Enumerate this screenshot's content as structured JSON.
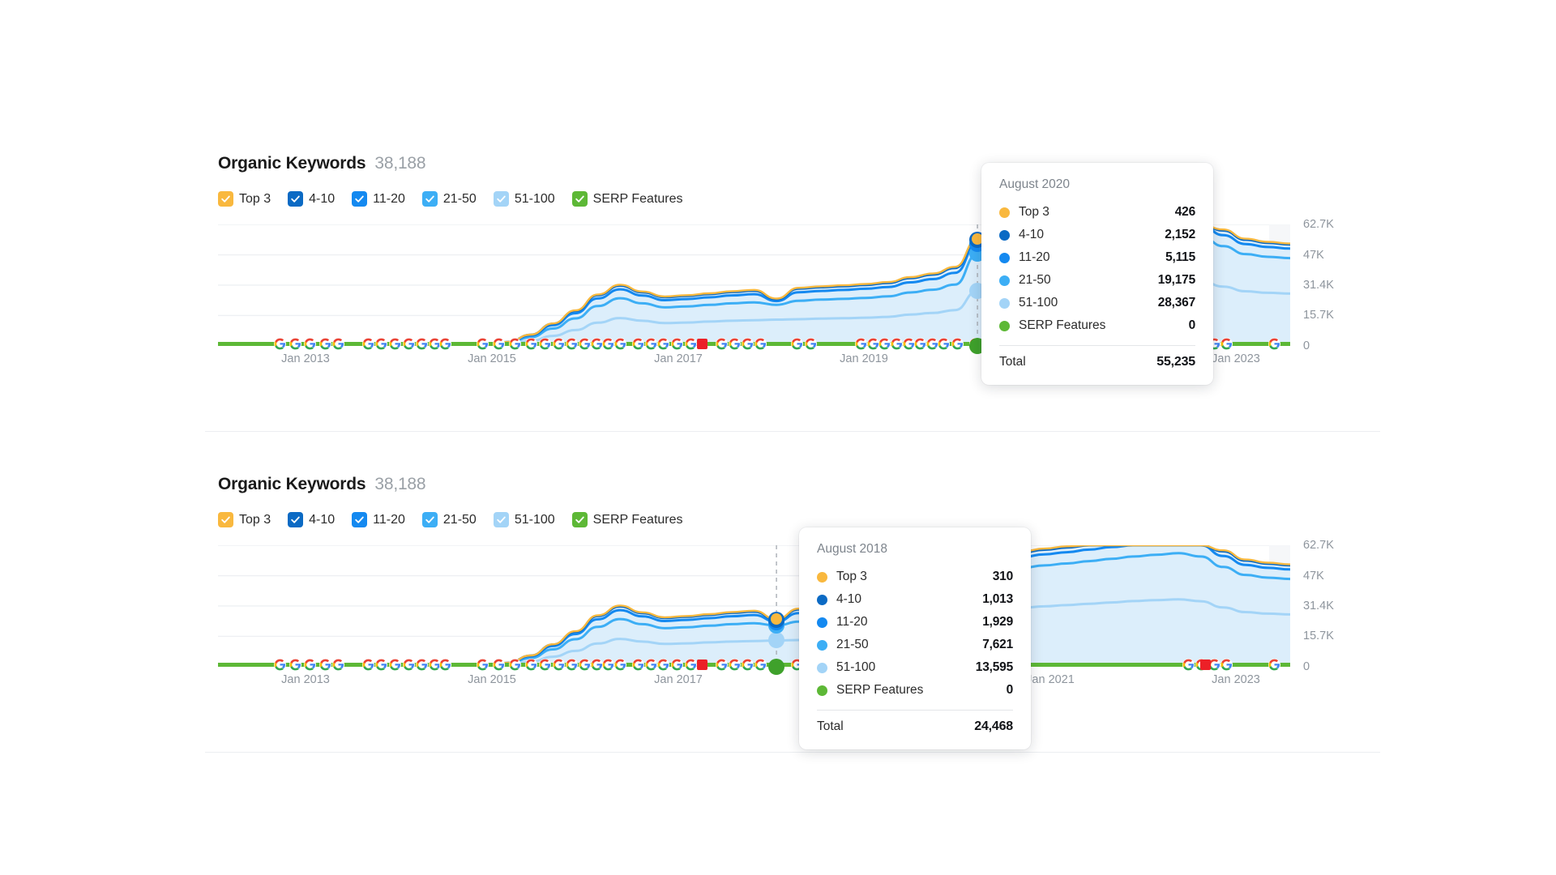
{
  "colors": {
    "top3": "#F9B83E",
    "p4_10": "#0B6AC4",
    "p11_20": "#1489F0",
    "p21_50": "#3CAEF5",
    "p51_100": "#A3D4F7",
    "serp": "#5DB836",
    "fill": "#DCEEFB",
    "grid": "#EEF0F3",
    "axis_text": "#8E959D",
    "tooltip_bg": "#FFFFFF",
    "muted_text": "#9AA0A6"
  },
  "charts": [
    {
      "id": "chart-1",
      "title": "Organic Keywords",
      "count": "38,188",
      "legend": [
        {
          "label": "Top 3",
          "color": "#F9B83E",
          "checked": true,
          "dim": false
        },
        {
          "label": "4-10",
          "color": "#0B6AC4",
          "checked": true,
          "dim": false
        },
        {
          "label": "11-20",
          "color": "#1489F0",
          "checked": true,
          "dim": false
        },
        {
          "label": "21-50",
          "color": "#3CAEF5",
          "checked": true,
          "dim": false
        },
        {
          "label": "51-100",
          "color": "#A3D4F7",
          "checked": true,
          "dim": true
        },
        {
          "label": "SERP Features",
          "color": "#5DB836",
          "checked": true,
          "dim": false
        }
      ],
      "tooltip": {
        "date": "August 2020",
        "rows": [
          {
            "label": "Top 3",
            "value": "426",
            "color": "#F9B83E"
          },
          {
            "label": "4-10",
            "value": "2,152",
            "color": "#0B6AC4"
          },
          {
            "label": "11-20",
            "value": "5,115",
            "color": "#1489F0"
          },
          {
            "label": "21-50",
            "value": "19,175",
            "color": "#3CAEF5"
          },
          {
            "label": "51-100",
            "value": "28,367",
            "color": "#A3D4F7"
          },
          {
            "label": "SERP Features",
            "value": "0",
            "color": "#5DB836"
          }
        ],
        "total_label": "Total",
        "total_value": "55,235"
      }
    },
    {
      "id": "chart-2",
      "title": "Organic Keywords",
      "count": "38,188",
      "legend": [
        {
          "label": "Top 3",
          "color": "#F9B83E",
          "checked": true,
          "dim": false
        },
        {
          "label": "4-10",
          "color": "#0B6AC4",
          "checked": true,
          "dim": false
        },
        {
          "label": "11-20",
          "color": "#1489F0",
          "checked": true,
          "dim": false
        },
        {
          "label": "21-50",
          "color": "#3CAEF5",
          "checked": true,
          "dim": false
        },
        {
          "label": "51-100",
          "color": "#A3D4F7",
          "checked": true,
          "dim": true
        },
        {
          "label": "SERP Features",
          "color": "#5DB836",
          "checked": true,
          "dim": false
        }
      ],
      "tooltip": {
        "date": "August 2018",
        "rows": [
          {
            "label": "Top 3",
            "value": "310",
            "color": "#F9B83E"
          },
          {
            "label": "4-10",
            "value": "1,013",
            "color": "#0B6AC4"
          },
          {
            "label": "11-20",
            "value": "1,929",
            "color": "#1489F0"
          },
          {
            "label": "21-50",
            "value": "7,621",
            "color": "#3CAEF5"
          },
          {
            "label": "51-100",
            "value": "13,595",
            "color": "#A3D4F7"
          },
          {
            "label": "SERP Features",
            "value": "0",
            "color": "#5DB836"
          }
        ],
        "total_label": "Total",
        "total_value": "24,468"
      }
    }
  ],
  "chart_data": {
    "type": "area",
    "title": "Organic Keywords",
    "subtitle": "38,188",
    "stacked": true,
    "grid": true,
    "legend_position": "top-left",
    "xlabel": "",
    "ylabel": "",
    "ylim": [
      0,
      62700
    ],
    "yticks": [
      0,
      15700,
      31400,
      47000,
      62700
    ],
    "ytick_labels": [
      "0",
      "15.7K",
      "31.4K",
      "47K",
      "62.7K"
    ],
    "xtick_labels": [
      "Jan 2013",
      "Jan 2015",
      "Jan 2017",
      "Jan 2019",
      "Jan 2021",
      "Jan 2023"
    ],
    "x": [
      "2012-01",
      "2012-04",
      "2012-07",
      "2012-10",
      "2013-01",
      "2013-04",
      "2013-07",
      "2013-10",
      "2014-01",
      "2014-04",
      "2014-07",
      "2014-10",
      "2015-01",
      "2015-04",
      "2015-07",
      "2015-10",
      "2016-01",
      "2016-04",
      "2016-07",
      "2016-10",
      "2017-01",
      "2017-04",
      "2017-07",
      "2017-10",
      "2018-01",
      "2018-04",
      "2018-07",
      "2018-10",
      "2019-01",
      "2019-04",
      "2019-07",
      "2019-10",
      "2020-01",
      "2020-04",
      "2020-08",
      "2020-10",
      "2021-01",
      "2021-04",
      "2021-07",
      "2021-10",
      "2022-01",
      "2022-04",
      "2022-07",
      "2022-10",
      "2023-01",
      "2023-04",
      "2023-07",
      "2023-10",
      "2024-01"
    ],
    "series": [
      {
        "name": "51-100",
        "color": "#A3D4F7",
        "values": [
          120,
          140,
          150,
          160,
          180,
          200,
          210,
          230,
          240,
          260,
          280,
          300,
          320,
          900,
          2600,
          5200,
          8200,
          12000,
          14400,
          13000,
          11800,
          12100,
          12600,
          13000,
          13300,
          13595,
          13800,
          14100,
          14300,
          14600,
          15000,
          16200,
          17000,
          18500,
          28367,
          29000,
          30500,
          31200,
          31800,
          32500,
          33200,
          33900,
          34400,
          34800,
          33800,
          30600,
          28200,
          27400,
          27000
        ]
      },
      {
        "name": "21-50",
        "color": "#3CAEF5",
        "values": [
          90,
          100,
          110,
          120,
          130,
          150,
          160,
          170,
          180,
          200,
          220,
          240,
          260,
          700,
          1900,
          3800,
          6000,
          8600,
          10200,
          9000,
          8100,
          8300,
          8600,
          9000,
          9200,
          7621,
          9500,
          9800,
          10000,
          10200,
          10600,
          11400,
          12000,
          13200,
          19175,
          19800,
          20600,
          21100,
          21500,
          22000,
          22500,
          23000,
          23400,
          23800,
          23100,
          20900,
          19200,
          18600,
          18300
        ]
      },
      {
        "name": "11-20",
        "color": "#1489F0",
        "values": [
          40,
          45,
          50,
          55,
          60,
          65,
          70,
          75,
          80,
          90,
          100,
          110,
          120,
          320,
          880,
          1700,
          2700,
          3900,
          4600,
          4000,
          3700,
          3800,
          3900,
          4100,
          4200,
          1929,
          4400,
          4500,
          4600,
          4700,
          4850,
          5200,
          5500,
          6000,
          5115,
          5300,
          5550,
          5700,
          5800,
          5950,
          6100,
          6250,
          6350,
          6450,
          6250,
          5650,
          5200,
          5050,
          4950
        ]
      },
      {
        "name": "4-10",
        "color": "#0B6AC4",
        "values": [
          20,
          22,
          24,
          26,
          28,
          30,
          32,
          34,
          36,
          40,
          44,
          48,
          52,
          140,
          380,
          740,
          1150,
          1650,
          1950,
          1700,
          1570,
          1610,
          1660,
          1740,
          1780,
          1013,
          1870,
          1910,
          1950,
          1990,
          2050,
          2200,
          2330,
          2540,
          2152,
          2250,
          2350,
          2410,
          2460,
          2520,
          2580,
          2650,
          2690,
          2730,
          2650,
          2400,
          2200,
          2140,
          2100
        ]
      },
      {
        "name": "Top 3",
        "color": "#F9B83E",
        "values": [
          6,
          7,
          7,
          8,
          8,
          9,
          9,
          10,
          10,
          11,
          12,
          13,
          14,
          36,
          95,
          180,
          280,
          400,
          470,
          410,
          380,
          390,
          400,
          420,
          430,
          310,
          450,
          460,
          470,
          480,
          495,
          530,
          560,
          610,
          426,
          540,
          565,
          580,
          592,
          606,
          620,
          636,
          646,
          656,
          636,
          576,
          528,
          514,
          504
        ]
      },
      {
        "name": "SERP Features",
        "color": "#5DB836",
        "values": [
          0,
          0,
          0,
          0,
          0,
          0,
          0,
          0,
          0,
          0,
          0,
          0,
          0,
          0,
          0,
          0,
          0,
          0,
          0,
          0,
          0,
          0,
          0,
          0,
          0,
          0,
          0,
          0,
          0,
          0,
          0,
          0,
          0,
          0,
          0,
          0,
          0,
          0,
          0,
          0,
          0,
          0,
          0,
          0,
          0,
          0,
          0,
          0,
          0
        ]
      }
    ],
    "annotations": [
      {
        "type": "algorithm-update-marker",
        "icon": "google-g-icon",
        "label": "Google algorithm update"
      },
      {
        "type": "algorithm-update-marker",
        "icon": "red-square-icon",
        "label": "Major update"
      },
      {
        "type": "hover-cursor-line",
        "chart": "chart-1",
        "at": "August 2020"
      },
      {
        "type": "hover-cursor-line",
        "chart": "chart-2",
        "at": "August 2018"
      }
    ]
  }
}
